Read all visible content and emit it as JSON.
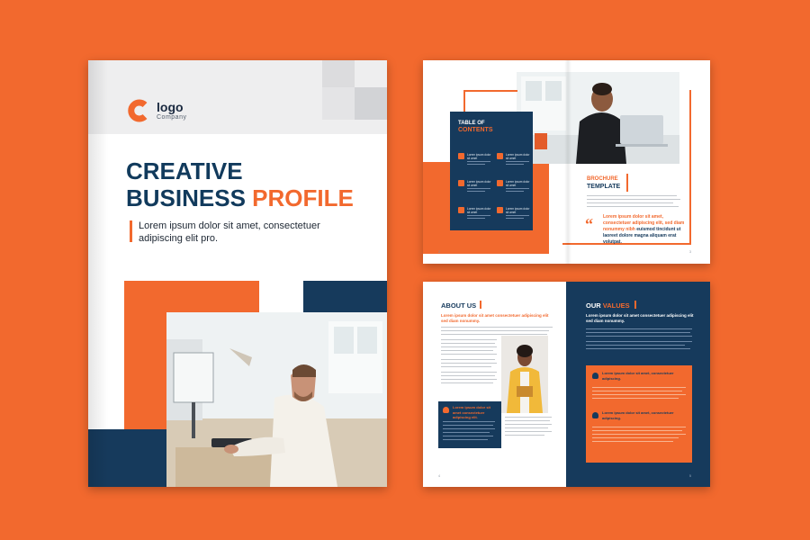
{
  "colors": {
    "background": "#f2692e",
    "navy": "#163a5c",
    "orange": "#f2692e",
    "white": "#ffffff"
  },
  "cover": {
    "logo_letter": "C",
    "logo_word": "logo",
    "logo_sub": "Company",
    "title_line1": "CREATIVE",
    "title_line2a": "BUSINESS ",
    "title_line2b": "PROFILE",
    "subtitle": "Lorem ipsum dolor sit amet, consectetuer adipiscing elit pro."
  },
  "spread1": {
    "toc_title_1": "TABLE OF",
    "toc_title_2": "CONTENTS",
    "toc_items": [
      "Lorem ipsum dolor sit amet",
      "Lorem ipsum dolor sit amet",
      "Lorem ipsum dolor sit amet",
      "Lorem ipsum dolor sit amet",
      "Lorem ipsum dolor sit amet",
      "Lorem ipsum dolor sit amet"
    ],
    "brochure_1": "BROCHURE",
    "brochure_2": "TEMPLATE",
    "quote_mark": "“",
    "quote_orange": "Lorem ipsum dolor sit amet, consectetuer adipiscing elit, sed diam nonummy nibh ",
    "quote_navy": "euismod tincidunt ut laoreet dolore magna aliquam erat volutpat.",
    "footer_left": "2",
    "footer_right": "3"
  },
  "spread2": {
    "about_heading": "ABOUT US",
    "about_lead": "Lorem ipsum dolor sit amet consectetuer adipiscing elit sed diam nonummy.",
    "about_box_text": "Lorem ipsum dolor sit amet consectetuer adipiscing elit.",
    "values_heading_a": "OUR ",
    "values_heading_b": "VALUES",
    "values_lead": "Lorem ipsum dolor sit amet consectetuer adipiscing elit sed diam nonummy.",
    "value_item_1": "Lorem ipsum dolor sit amet, consectetuer adipiscing.",
    "value_item_2": "Lorem ipsum dolor sit amet, consectetuer adipiscing.",
    "footer_left": "4",
    "footer_right": "5"
  }
}
